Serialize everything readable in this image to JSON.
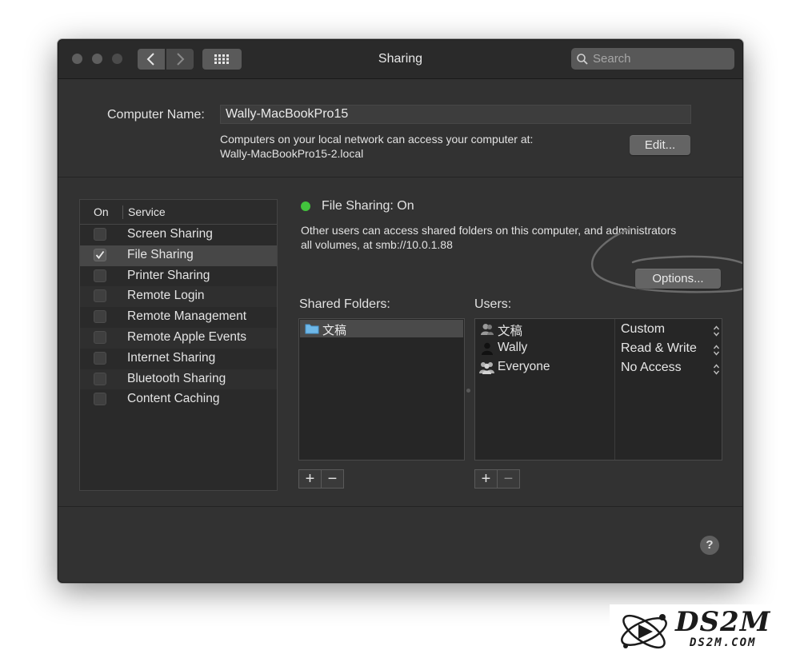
{
  "window": {
    "title": "Sharing",
    "search_placeholder": "Search"
  },
  "computer_name": {
    "label": "Computer Name:",
    "value": "Wally-MacBookPro15",
    "info_line1": "Computers on your local network can access your computer at:",
    "info_line2": "Wally-MacBookPro15-2.local",
    "edit_label": "Edit..."
  },
  "services": {
    "col_on": "On",
    "col_service": "Service",
    "items": [
      {
        "label": "Screen Sharing",
        "checked": false
      },
      {
        "label": "File Sharing",
        "checked": true
      },
      {
        "label": "Printer Sharing",
        "checked": false
      },
      {
        "label": "Remote Login",
        "checked": false
      },
      {
        "label": "Remote Management",
        "checked": false
      },
      {
        "label": "Remote Apple Events",
        "checked": false
      },
      {
        "label": "Internet Sharing",
        "checked": false
      },
      {
        "label": "Bluetooth Sharing",
        "checked": false
      },
      {
        "label": "Content Caching",
        "checked": false
      }
    ]
  },
  "file_sharing": {
    "status": "File Sharing: On",
    "status_color": "#42c33d",
    "desc_line1": "Other users can access shared folders on this computer, and administrators",
    "desc_line2": "all volumes, at smb://10.0.1.88",
    "options_label": "Options..."
  },
  "shared_folders": {
    "label": "Shared Folders:",
    "items": [
      "文稿"
    ],
    "add": "+",
    "remove": "−"
  },
  "users": {
    "label": "Users:",
    "items": [
      {
        "name": "文稿",
        "permission": "Custom",
        "icon": "user-icon"
      },
      {
        "name": "Wally",
        "permission": "Read & Write",
        "icon": "person-icon"
      },
      {
        "name": "Everyone",
        "permission": "No Access",
        "icon": "group-icon"
      }
    ],
    "add": "+",
    "remove": "−"
  },
  "help": "?",
  "watermark": {
    "brand": "DS2M",
    "url": "DS2M.COM"
  }
}
